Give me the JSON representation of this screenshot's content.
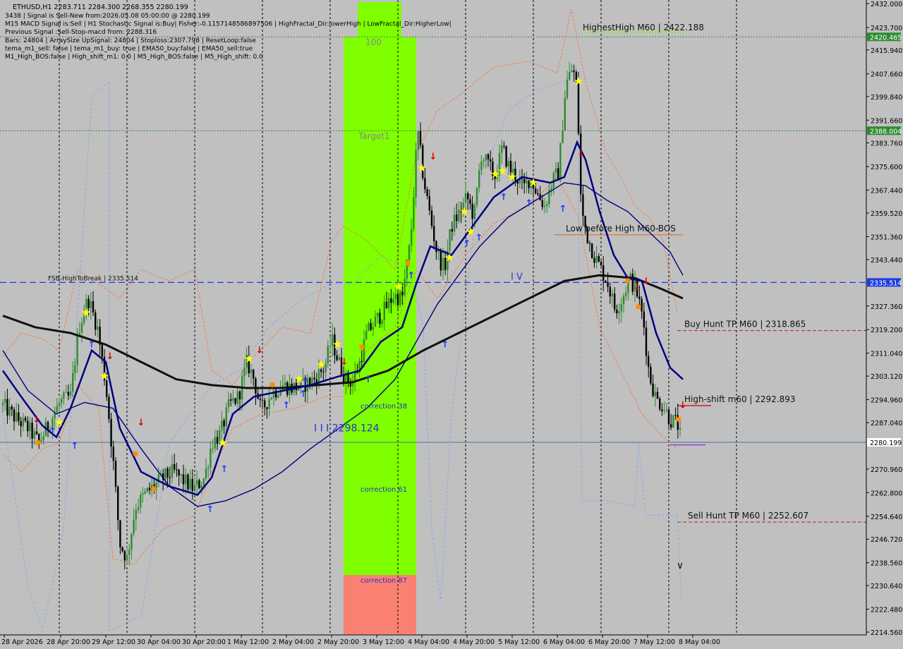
{
  "chart_data": {
    "type": "candlestick",
    "symbol_line": "ETHUSD,H1  2283.711 2284.300 2268.355 2280.199",
    "info_lines": [
      "3438 | Signal is Sell-New from:2026.05.08 05:00:00 @ 2280.199",
      "M15 MACD Signal is:Sell | H1 Stochastic Signal is:Buy| Fisher:-0.1157148586897506 | HighFractal_Dir:lowerHigh | LowFractal_Dir:HigherLow|",
      "Previous Signal :Sell-Stop-macd from: 2288.316",
      "Bars: 24804 | ArraySize UpSignal: 24804 | Stoploss:2307.798 | ResetLoop:false",
      "tema_m1_sell: false | tema_m1_buy: true | EMA50_buy:false | EMA50_sell:true",
      "M1_High_BOS:false | High_shift_m1: 0.0 | M5_High_BOS:false | M5_High_shift: 0.0"
    ],
    "y_ticks": [
      2432.0,
      2423.7,
      2415.94,
      2407.66,
      2399.84,
      2391.66,
      2383.76,
      2375.6,
      2367.44,
      2359.52,
      2351.36,
      2343.44,
      2335.514,
      2327.36,
      2319.2,
      2311.04,
      2303.12,
      2294.96,
      2287.04,
      2280.199,
      2270.96,
      2262.8,
      2254.64,
      2246.72,
      2238.56,
      2230.64,
      2222.48,
      2214.56
    ],
    "x_ticks": [
      "28 Apr 2026",
      "28 Apr 20:00",
      "29 Apr 12:00",
      "30 Apr 04:00",
      "30 Apr 20:00",
      "1 May 12:00",
      "2 May 04:00",
      "2 May 20:00",
      "3 May 12:00",
      "4 May 04:00",
      "4 May 20:00",
      "5 May 12:00",
      "6 May 04:00",
      "6 May 20:00",
      "7 May 12:00",
      "8 May 04:00"
    ],
    "price_tags": [
      {
        "label": "2420.465",
        "value": 2420.465,
        "color": "#2e8b2e"
      },
      {
        "label": "2388.004",
        "value": 2388.004,
        "color": "#2e8b2e"
      },
      {
        "label": "2335.514",
        "value": 2335.514,
        "color": "#1e3ce0"
      },
      {
        "label": "2280.199",
        "value": 2280.199,
        "color": "#ffffff"
      }
    ],
    "levels": [
      {
        "label": "HighestHigh   M60 | 2422.188",
        "value": 2422.188
      },
      {
        "label": "FSB-HighToBreak | 2335.514",
        "value": 2335.514
      },
      {
        "label": "Low before High   M60-BOS",
        "value": 2352.0
      },
      {
        "label": "Buy Hunt TP M60 | 2318.865",
        "value": 2318.865
      },
      {
        "label": "High-shift m60 | 2292.893",
        "value": 2292.893
      },
      {
        "label": "Sell Hunt TP M60 | 2252.607",
        "value": 2252.607
      },
      {
        "label": "I I I 2298.124",
        "value": 2298.124
      }
    ],
    "zone_labels": [
      "100",
      "Target1",
      "correction 38",
      "correction 61",
      "correction 87"
    ],
    "level_mark": "I V",
    "colors": {
      "background": "#c0c0c0",
      "zone_green": "#7fff00",
      "zone_red": "#fa8072",
      "ema": "#000080",
      "sma": "#101010",
      "candle_up": "#2e8b2e",
      "candle_down": "#000000"
    }
  }
}
